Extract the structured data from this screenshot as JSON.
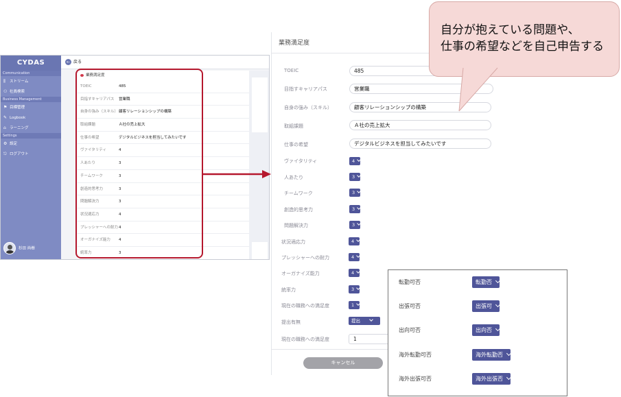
{
  "callout": {
    "line1": "自分が抱えている問題や、",
    "line2": "仕事の希望などを自己申告する"
  },
  "app": {
    "brand": "CYDAS",
    "back_label": "戻る",
    "sections": {
      "communication": "Communication",
      "business": "Business Management",
      "settings": "Settings"
    },
    "nav": {
      "stream": "ストリーム",
      "employee_search": "社員検索",
      "goals": "目標管理",
      "logbook": "Logbook",
      "learning": "ラーニング",
      "settings": "設定",
      "logout": "ログアウト"
    },
    "user_name": "杉田 尚樹",
    "form_title": "業務満足度",
    "rows": [
      {
        "k": "TOEIC",
        "v": "485"
      },
      {
        "k": "目指すキャリアパス",
        "v": "営業職"
      },
      {
        "k": "自身の強み（スキル）",
        "v": "顧客リレーションシップの構築"
      },
      {
        "k": "取組課題",
        "v": "Ａ社の売上拡大"
      },
      {
        "k": "仕事の希望",
        "v": "デジタルビジネスを担当してみたいです"
      },
      {
        "k": "ヴァイタリティ",
        "v": "4"
      },
      {
        "k": "人あたり",
        "v": "3"
      },
      {
        "k": "チームワーク",
        "v": "3"
      },
      {
        "k": "創造的思考力",
        "v": "3"
      },
      {
        "k": "問題解決力",
        "v": "3"
      },
      {
        "k": "状況適応力",
        "v": "4"
      },
      {
        "k": "プレッシャーへの耐力",
        "v": "4"
      },
      {
        "k": "オーガナイズ能力",
        "v": "4"
      },
      {
        "k": "統率力",
        "v": "3"
      }
    ]
  },
  "form": {
    "title": "業務満足度",
    "toeic_label": "TOEIC",
    "toeic_value": "485",
    "career_label": "目指すキャリアパス",
    "career_value": "営業職",
    "strength_label": "自身の強み（スキル）",
    "strength_value": "顧客リレーションシップの構築",
    "task_label": "取組課題",
    "task_value": "Ａ社の売上拡大",
    "wish_label": "仕事の希望",
    "wish_value": "デジタルビジネスを担当してみたいです",
    "vitality_label": "ヴァイタリティ",
    "vitality_value": "4",
    "manner_label": "人あたり",
    "manner_value": "3",
    "teamwork_label": "チームワーク",
    "teamwork_value": "3",
    "creative_label": "創造的思考力",
    "creative_value": "3",
    "problem_label": "問題解決力",
    "problem_value": "3",
    "adapt_label": "状況適応力",
    "adapt_value": "4",
    "pressure_label": "プレッシャーへの耐力",
    "pressure_value": "4",
    "organize_label": "オーガナイズ能力",
    "organize_value": "4",
    "leadership_label": "統率力",
    "leadership_value": "3",
    "satisfaction_label": "現在の職務への満足度",
    "satisfaction_value": "1",
    "attendance_label": "提出有無",
    "attendance_value": "提出",
    "satisfaction2_label": "現在の職務への満足度",
    "satisfaction2_value": "1",
    "cancel_label": "キャンセル"
  },
  "popup": {
    "transfer_label": "転勤可否",
    "transfer_value": "転勤否",
    "trip_label": "出張可否",
    "trip_value": "出張可",
    "secondment_label": "出向可否",
    "secondment_value": "出向否",
    "overseas_transfer_label": "海外転勤可否",
    "overseas_transfer_value": "海外転勤否",
    "overseas_trip_label": "海外出張可否",
    "overseas_trip_value": "海外出張否"
  }
}
